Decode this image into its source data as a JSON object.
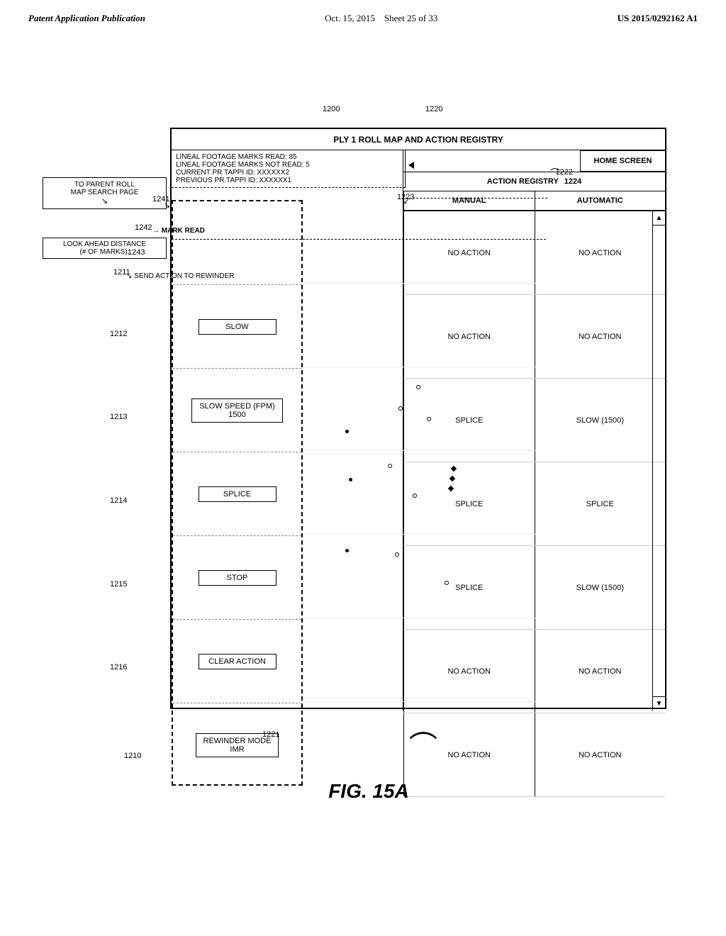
{
  "header": {
    "left": "Patent Application Publication",
    "center_date": "Oct. 15, 2015",
    "center_sheet": "Sheet 25 of 33",
    "right": "US 2015/0292162 A1"
  },
  "figure": {
    "number": "1200",
    "ref_1220": "1220",
    "ref_1222": "1222",
    "ref_1223": "1223",
    "ref_1224": "1224",
    "ref_1241": "1241",
    "ref_1242": "1242",
    "ref_1243": "1243",
    "ref_1211": "1211",
    "ref_1212": "1212",
    "ref_1213": "1213",
    "ref_1214": "1214",
    "ref_1215": "1215",
    "ref_1216": "1216",
    "ref_1221": "1221",
    "ref_1210": "1210",
    "title": "FIG. 15A"
  },
  "diagram": {
    "home_screen": "HOME SCREEN",
    "top_label": "PLY 1 ROLL MAP AND ACTION REGISTRY",
    "info_line1": "LINEAL FOOTAGE MARKS READ: 85",
    "info_line2": "LINEAL FOOTAGE MARKS NOT READ: 5",
    "info_line3": "CURRENT PR TAPPI ID: XXXXXX2",
    "info_line4": "PREVIOUS PR TAPPI ID: XXXXXX1",
    "action_registry_label": "ACTION REGISTRY",
    "manual_label": "MANUAL",
    "automatic_label": "AUTOMATIC",
    "to_parent_roll": "TO PARENT ROLL",
    "map_search": "MAP SEARCH PAGE",
    "mark_read": "MARK READ",
    "look_ahead": "LOOK AHEAD DISTANCE",
    "look_ahead_sub": "(# OF MARKS):",
    "send_action": "SEND ACTION TO REWINDER",
    "rows": [
      {
        "left_label": "",
        "left_sublabel": "",
        "manual": "NO ACTION",
        "automatic": "NO ACTION"
      },
      {
        "left_label": "SLOW",
        "left_sublabel": "",
        "manual": "NO ACTION",
        "automatic": "NO ACTION"
      },
      {
        "left_label": "SLOW SPEED (FPM)",
        "left_sublabel": "1500",
        "manual": "SPLICE",
        "automatic": "SLOW (1500)"
      },
      {
        "left_label": "SPLICE",
        "left_sublabel": "",
        "manual": "SPLICE",
        "automatic": "SPLICE"
      },
      {
        "left_label": "STOP",
        "left_sublabel": "",
        "manual": "SPLICE",
        "automatic": "SLOW (1500)"
      },
      {
        "left_label": "CLEAR ACTION",
        "left_sublabel": "",
        "manual": "NO ACTION",
        "automatic": "NO ACTION"
      },
      {
        "left_label": "REWINDER MODE",
        "left_sublabel": "IMR",
        "manual": "NO ACTION",
        "automatic": "NO ACTION"
      }
    ]
  }
}
